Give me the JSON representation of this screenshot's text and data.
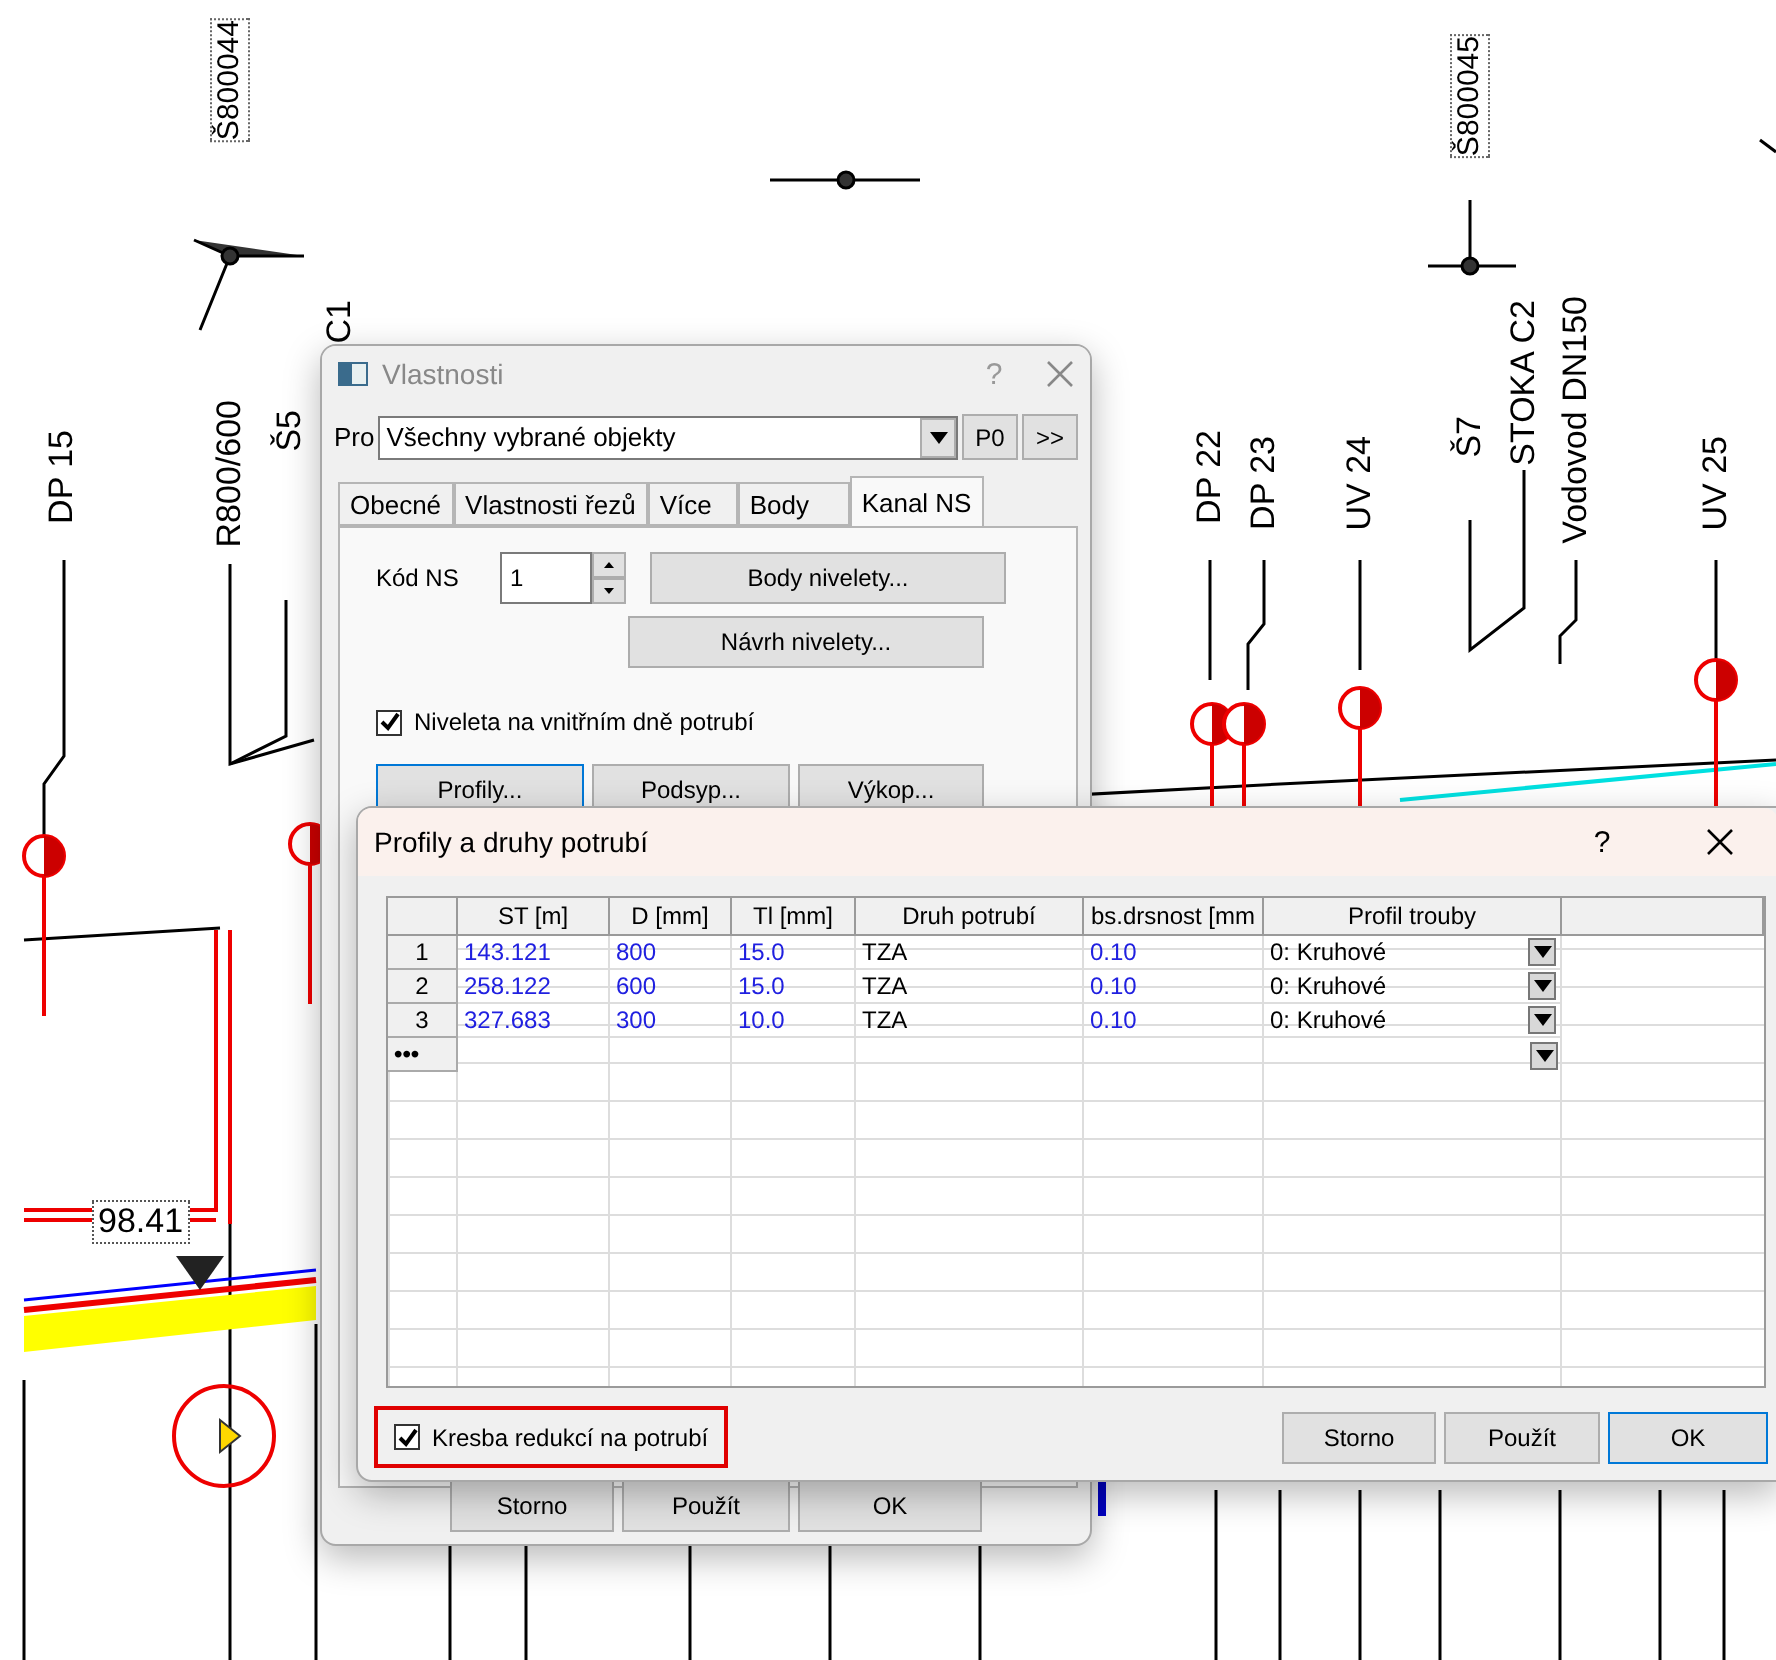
{
  "canvas": {
    "labels": [
      "Š800044",
      "Š800045",
      "C1",
      "DP 15",
      "R800/600",
      "Š5",
      "DP 22",
      "DP 23",
      "UV 24",
      "Š7",
      "STOKA C2",
      "Vodovod DN150",
      "UV 25"
    ],
    "level_marker": "98.41"
  },
  "properties_dialog": {
    "title": "Vlastnosti",
    "help": "?",
    "for_label": "Pro",
    "for_value": "Všechny vybrané objekty",
    "p0_button": "P0",
    "more_button": ">>",
    "tabs": [
      {
        "label": "Obecné",
        "selected": false
      },
      {
        "label": "Vlastnosti řezů",
        "selected": false
      },
      {
        "label": "Více",
        "selected": false
      },
      {
        "label": "Body",
        "selected": false
      },
      {
        "label": "Kanal NS",
        "selected": true
      }
    ],
    "code_label": "Kód NS",
    "code_value": "1",
    "level_buttons": [
      "Body nivelety...",
      "Návrh nivelety..."
    ],
    "checkbox": {
      "label": "Niveleta na vnitřním dně potrubí",
      "checked": true
    },
    "section_buttons": [
      "Profily...",
      "Podsyp...",
      "Výkop..."
    ],
    "footer_buttons": [
      "Storno",
      "Použít",
      "OK"
    ]
  },
  "profiles_dialog": {
    "title": "Profily a druhy potrubí",
    "help": "?",
    "table": {
      "columns": [
        "ST [m]",
        "D [mm]",
        "Tl [mm]",
        "Druh potrubí",
        "bs.drsnost [mm",
        "Profil trouby"
      ],
      "rows": [
        {
          "index": "1",
          "cells": [
            "143.121",
            "800",
            "15.0",
            "TZA",
            "0.10",
            "0: Kruhové"
          ]
        },
        {
          "index": "2",
          "cells": [
            "258.122",
            "600",
            "15.0",
            "TZA",
            "0.10",
            "0: Kruhové"
          ]
        },
        {
          "index": "3",
          "cells": [
            "327.683",
            "300",
            "10.0",
            "TZA",
            "0.10",
            "0: Kruhové"
          ]
        }
      ],
      "new_row_marker": "•••"
    },
    "checkbox": {
      "label": "Kresba redukcí na potrubí",
      "checked": true
    },
    "buttons": [
      "Storno",
      "Použít",
      "OK"
    ]
  }
}
